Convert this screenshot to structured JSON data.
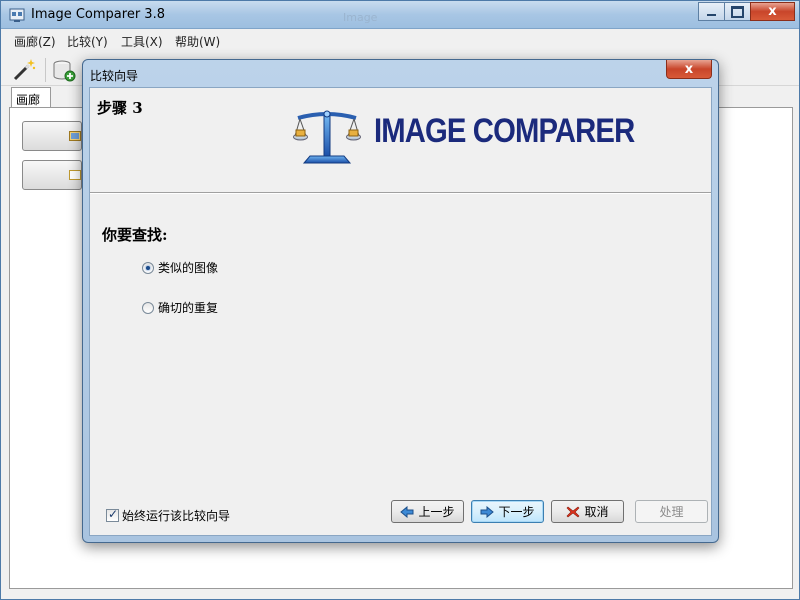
{
  "app": {
    "title": "Image Comparer 3.8",
    "ghost_title": "Image"
  },
  "menu": {
    "items": [
      "画廊(Z)",
      "比较(Y)",
      "工具(X)",
      "帮助(W)"
    ]
  },
  "tabs": {
    "gallery": "画廊"
  },
  "dialog": {
    "title": "比较向导",
    "step": "步骤 3",
    "logo_text": "IMAGE COMPARER",
    "question": "你要查找:",
    "options": [
      {
        "label": "类似的图像",
        "checked": true
      },
      {
        "label": "确切的重复",
        "checked": false
      }
    ],
    "always_run_label": "始终运行该比较向导",
    "always_run_checked": true,
    "buttons": {
      "back": "上一步",
      "next": "下一步",
      "cancel": "取消",
      "process": "处理"
    }
  },
  "colors": {
    "logo_text": "#1b2a7c",
    "titlebar": "#a8c6e4",
    "close_button": "#c8452a",
    "focus_button": "#3c7fb1"
  },
  "icons": {
    "app": "app-window-icon",
    "wand": "magic-wand-icon",
    "add_gallery": "add-gallery-icon",
    "logo": "balance-scale-icon",
    "back": "arrow-left-icon",
    "next": "arrow-right-icon",
    "cancel": "red-x-icon"
  }
}
